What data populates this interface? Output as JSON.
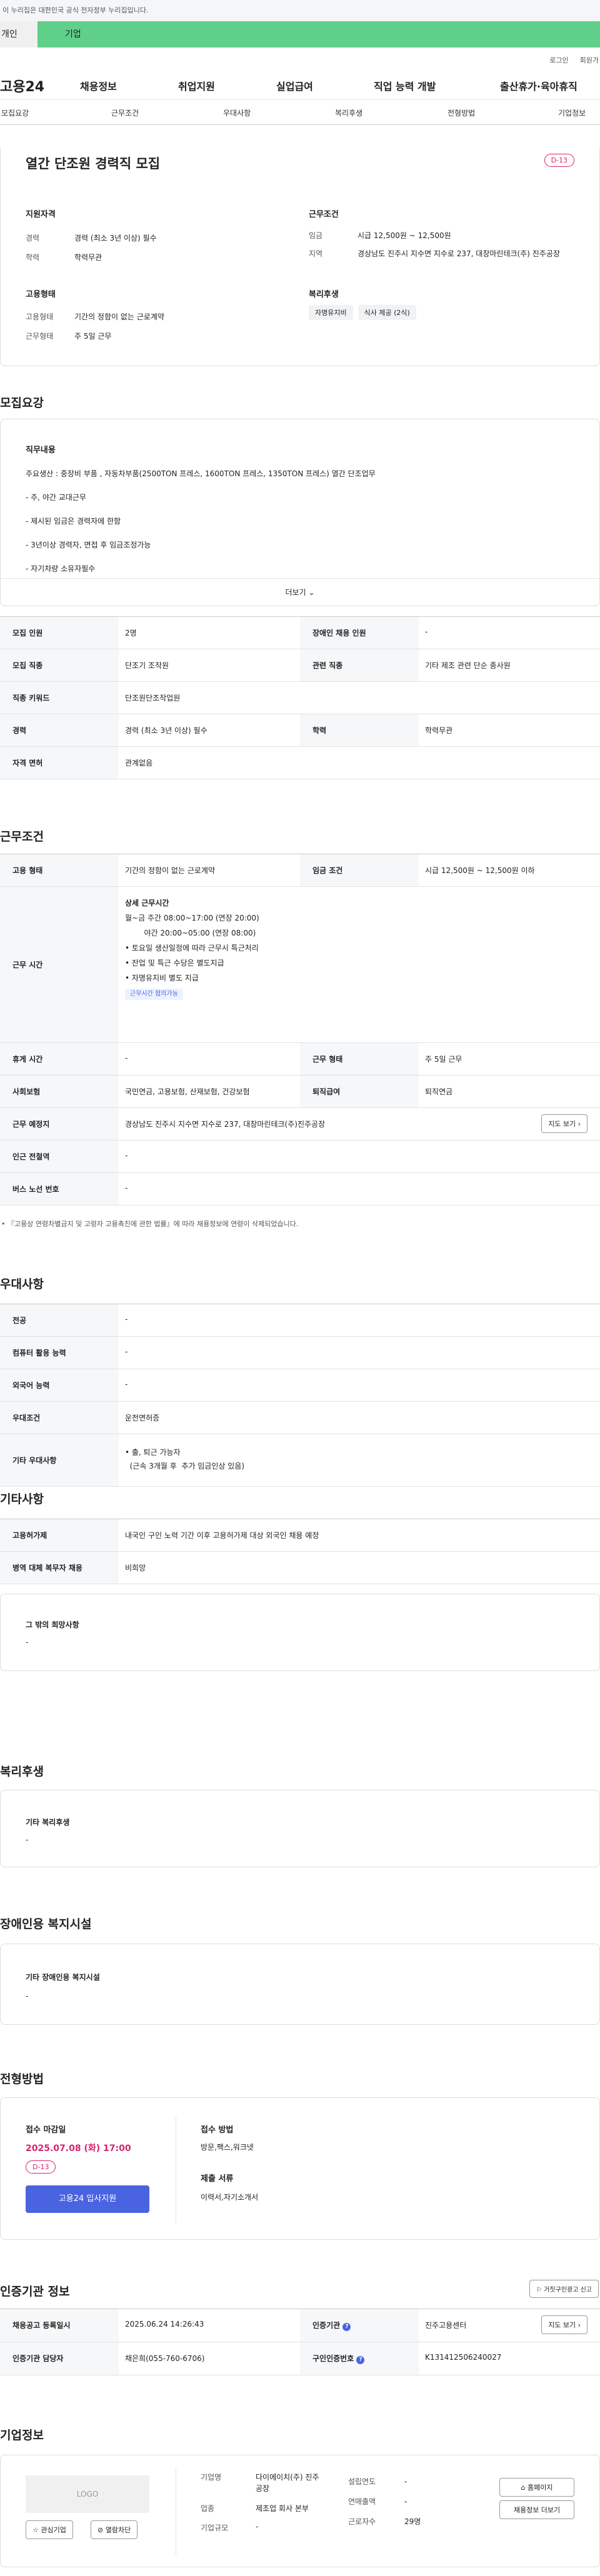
{
  "gov": {
    "notice": "이 누리집은 대한민국 공식 전자정부 누리집입니다."
  },
  "cattabs": [
    "개인",
    "기업"
  ],
  "util": [
    "로그인",
    "회원가"
  ],
  "gnb": {
    "logo": "고용24",
    "items": [
      "채용정보",
      "취업지원",
      "실업급여",
      "직업 능력 개발",
      "출산휴가·육아휴직"
    ]
  },
  "tabs": [
    "모집요강",
    "근무조건",
    "우대사항",
    "복리후생",
    "전형방법",
    "기업정보"
  ],
  "job": {
    "title": "열간 단조원 경력직 모집",
    "dday": "D-13",
    "qual_title": "지원자격",
    "qual": [
      [
        "경력",
        "경력 (최소 3년 이상) 필수"
      ],
      [
        "학력",
        "학력무관"
      ]
    ],
    "cond_title": "근무조건",
    "cond": [
      [
        "임금",
        "시급 12,500원 ~ 12,500원"
      ],
      [
        "지역",
        "경상남도 진주시 지수면 지수로 237, 대창마린테크(주) 진주공장"
      ]
    ],
    "emp_title": "고용형태",
    "emp": [
      [
        "고용형태",
        "기간의 정함이 없는 근로계약"
      ],
      [
        "근무형태",
        "주 5일 근무"
      ]
    ],
    "welfare_title": "복리후생",
    "welfare_tags": [
      "자명유지비",
      "식사 제공 (2식)"
    ]
  },
  "recruit": {
    "title": "모집요강",
    "content_title": "직무내용",
    "lines": [
      "주요생산 : 중장비 부품 , 자동차부품(2500TON 프레스, 1600TON  프레스, 1350TON  프레스) 열간 단조업무",
      "- 주, 야간 교대근무",
      "- 제시된 임금은 경력자에 한함",
      "- 3년이상 경력자,  면접 후 임금조정가능",
      "- 자기차량 소유자필수"
    ],
    "more": "더보기",
    "rows": [
      [
        [
          "모집 인원",
          "2명"
        ],
        [
          "장애인 채용 인원",
          "-"
        ]
      ],
      [
        [
          "모집 직종",
          "단조기 조작원"
        ],
        [
          "관련 직종",
          "기타 제조 관련 단순 종사원"
        ]
      ],
      [
        [
          "직종 키워드",
          "단조원단조작업원"
        ]
      ],
      [
        [
          "경력",
          "경력 (최소 3년 이상) 필수"
        ],
        [
          "학력",
          "학력무관"
        ]
      ],
      [
        [
          "자격 면허",
          "관계없음"
        ]
      ]
    ]
  },
  "work": {
    "title": "근무조건",
    "r1": [
      [
        "고용 형태",
        "기간의 정함이 없는 근로계약"
      ],
      [
        "임금 조건",
        "시급 12,500원 ~ 12,500원 이하"
      ]
    ],
    "time_label": "근무 시간",
    "time_head": "상세 근무시간",
    "time_lines": [
      "월~금 주간 08:00~17:00 (연장 20:00)",
      "        야간 20:00~05:00 (연장 08:00)",
      "• 토요일 생산일정에 따라 근무시 특근처리",
      "• 잔업 및 특근 수당은 별도지급",
      "• 자명유지비 별도 지급"
    ],
    "time_tag": "근무시간 협의가능",
    "r2": [
      [
        "휴게 시간",
        "-"
      ],
      [
        "근무 형태",
        "주 5일 근무"
      ]
    ],
    "r3": [
      [
        "사회보험",
        "국민연금, 고용보험, 산재보험, 건강보험"
      ],
      [
        "퇴직급여",
        "퇴직연금"
      ]
    ],
    "place": [
      "근무 예정지",
      "경상남도 진주시 지수면 지수로 237, 대창마린테크(주)진주공장"
    ],
    "map_btn": "지도 보기",
    "r4": [
      "인근 전철역",
      "-"
    ],
    "r5": [
      "버스 노선 번호",
      "-"
    ],
    "note": "『고용상 연령차별금지 및 고령자 고용촉진에 관한 법률』에 따라 채용정보에 연령이 삭제되었습니다."
  },
  "pref": {
    "title": "우대사항",
    "rows": [
      [
        "전공",
        "-"
      ],
      [
        "컴퓨터 활용 능력",
        "-"
      ],
      [
        "외국어 능력",
        "-"
      ],
      [
        "우대조건",
        "운전면허증"
      ]
    ],
    "other_label": "기타 우대사항",
    "other_lines": [
      "• 출, 퇴근 가능자",
      "  (근속 3개월 후  추가 임금인상 있음)"
    ]
  },
  "etc": {
    "title": "기타사항",
    "rows": [
      [
        "고용허가제",
        "내국인 구인 노력 기간 이후 고용허가제 대상 외국인 채용 예정"
      ],
      [
        "병역 대체 복무자 채용",
        "비희망"
      ]
    ],
    "box_title": "그 밖의 희망사항",
    "box_val": "-"
  },
  "benefit": {
    "title": "복리후생",
    "box_title": "기타 복리후생",
    "box_val": "-"
  },
  "disab": {
    "title": "장애인용 복지시설",
    "box_title": "기타 장애인용 복지시설",
    "box_val": "-"
  },
  "process": {
    "title": "전형방법",
    "deadline_label": "접수 마감일",
    "deadline": "2025.07.08 (화) 17:00",
    "dday": "D-13",
    "apply_btn": "고용24 입사지원",
    "method_label": "접수 방법",
    "method": "방문,팩스,워크넷",
    "docs_label": "제출 서류",
    "docs": "이력서,자기소개서"
  },
  "agency": {
    "title": "인증기관 정보",
    "report_btn": "거짓구인광고 신고",
    "rows": [
      [
        [
          "채용공고 등록일시",
          "2025.06.24 14:26:43"
        ],
        [
          "인증기관",
          "진주고용센터"
        ]
      ],
      [
        [
          "인증기관 담당자",
          "채은희(055-760-6706)"
        ],
        [
          "구인인증번호",
          "K131412506240027"
        ]
      ]
    ],
    "map_btn": "지도 보기"
  },
  "company": {
    "title": "기업정보",
    "logo": "LOGO",
    "interest_btn": "관심기업",
    "block_btn": "열람차단",
    "fields": [
      [
        "기업명",
        "다이에이치(주) 진주공장"
      ],
      [
        "업종",
        "제조업 회사 본부"
      ],
      [
        "기업규모",
        "-"
      ]
    ],
    "fields2": [
      [
        "설립연도",
        "-"
      ],
      [
        "연매출액",
        "-"
      ],
      [
        "근로자수",
        "29명"
      ]
    ],
    "homepage_btn": "홈페이지",
    "more_btn": "채용정보 더보기"
  },
  "colors": {
    "green": "#5fcf8a",
    "blue": "#4a63e0",
    "red": "#d6246e"
  }
}
